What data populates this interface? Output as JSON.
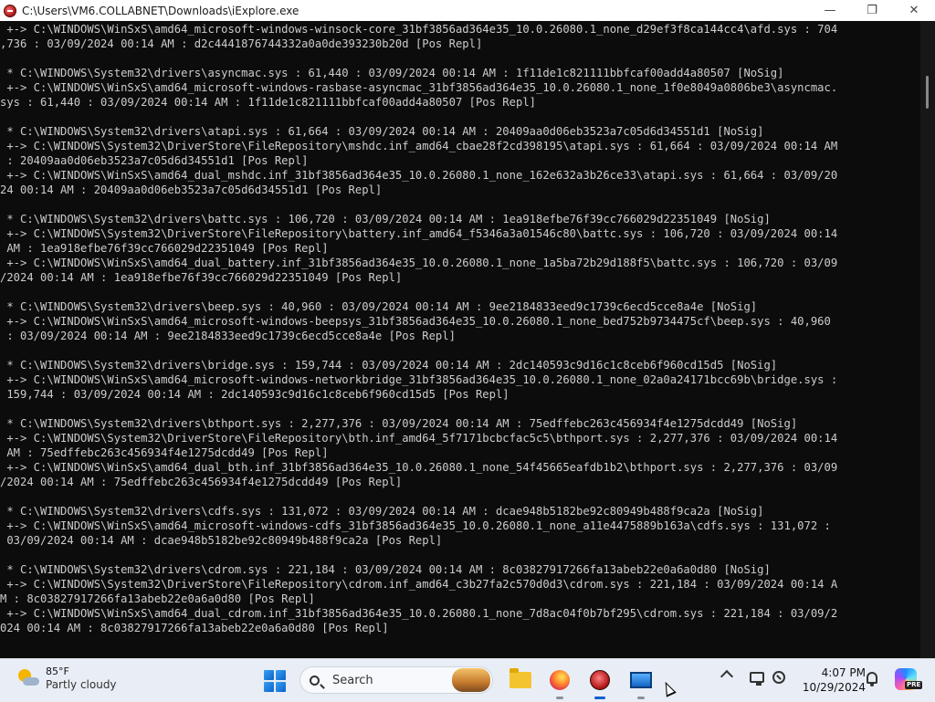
{
  "window": {
    "title": "C:\\Users\\VM6.COLLABNET\\Downloads\\iExplore.exe",
    "minimize_symbol": "—",
    "maximize_symbol": "❐",
    "close_symbol": "✕"
  },
  "console": {
    "lines": [
      " +-> C:\\WINDOWS\\WinSxS\\amd64_microsoft-windows-winsock-core_31bf3856ad364e35_10.0.26080.1_none_d29ef3f8ca144cc4\\afd.sys : 704",
      ",736 : 03/09/2024 00:14 AM : d2c4441876744332a0a0de393230b20d [Pos Repl]",
      "",
      " * C:\\WINDOWS\\System32\\drivers\\asyncmac.sys : 61,440 : 03/09/2024 00:14 AM : 1f11de1c821111bbfcaf00add4a80507 [NoSig]",
      " +-> C:\\WINDOWS\\WinSxS\\amd64_microsoft-windows-rasbase-asyncmac_31bf3856ad364e35_10.0.26080.1_none_1f0e8049a0806be3\\asyncmac.",
      "sys : 61,440 : 03/09/2024 00:14 AM : 1f11de1c821111bbfcaf00add4a80507 [Pos Repl]",
      "",
      " * C:\\WINDOWS\\System32\\drivers\\atapi.sys : 61,664 : 03/09/2024 00:14 AM : 20409aa0d06eb3523a7c05d6d34551d1 [NoSig]",
      " +-> C:\\WINDOWS\\System32\\DriverStore\\FileRepository\\mshdc.inf_amd64_cbae28f2cd398195\\atapi.sys : 61,664 : 03/09/2024 00:14 AM",
      " : 20409aa0d06eb3523a7c05d6d34551d1 [Pos Repl]",
      " +-> C:\\WINDOWS\\WinSxS\\amd64_dual_mshdc.inf_31bf3856ad364e35_10.0.26080.1_none_162e632a3b26ce33\\atapi.sys : 61,664 : 03/09/20",
      "24 00:14 AM : 20409aa0d06eb3523a7c05d6d34551d1 [Pos Repl]",
      "",
      " * C:\\WINDOWS\\System32\\drivers\\battc.sys : 106,720 : 03/09/2024 00:14 AM : 1ea918efbe76f39cc766029d22351049 [NoSig]",
      " +-> C:\\WINDOWS\\System32\\DriverStore\\FileRepository\\battery.inf_amd64_f5346a3a01546c80\\battc.sys : 106,720 : 03/09/2024 00:14",
      " AM : 1ea918efbe76f39cc766029d22351049 [Pos Repl]",
      " +-> C:\\WINDOWS\\WinSxS\\amd64_dual_battery.inf_31bf3856ad364e35_10.0.26080.1_none_1a5ba72b29d188f5\\battc.sys : 106,720 : 03/09",
      "/2024 00:14 AM : 1ea918efbe76f39cc766029d22351049 [Pos Repl]",
      "",
      " * C:\\WINDOWS\\System32\\drivers\\beep.sys : 40,960 : 03/09/2024 00:14 AM : 9ee2184833eed9c1739c6ecd5cce8a4e [NoSig]",
      " +-> C:\\WINDOWS\\WinSxS\\amd64_microsoft-windows-beepsys_31bf3856ad364e35_10.0.26080.1_none_bed752b9734475cf\\beep.sys : 40,960",
      " : 03/09/2024 00:14 AM : 9ee2184833eed9c1739c6ecd5cce8a4e [Pos Repl]",
      "",
      " * C:\\WINDOWS\\System32\\drivers\\bridge.sys : 159,744 : 03/09/2024 00:14 AM : 2dc140593c9d16c1c8ceb6f960cd15d5 [NoSig]",
      " +-> C:\\WINDOWS\\WinSxS\\amd64_microsoft-windows-networkbridge_31bf3856ad364e35_10.0.26080.1_none_02a0a24171bcc69b\\bridge.sys :",
      " 159,744 : 03/09/2024 00:14 AM : 2dc140593c9d16c1c8ceb6f960cd15d5 [Pos Repl]",
      "",
      " * C:\\WINDOWS\\System32\\drivers\\bthport.sys : 2,277,376 : 03/09/2024 00:14 AM : 75edffebc263c456934f4e1275dcdd49 [NoSig]",
      " +-> C:\\WINDOWS\\System32\\DriverStore\\FileRepository\\bth.inf_amd64_5f7171bcbcfac5c5\\bthport.sys : 2,277,376 : 03/09/2024 00:14",
      " AM : 75edffebc263c456934f4e1275dcdd49 [Pos Repl]",
      " +-> C:\\WINDOWS\\WinSxS\\amd64_dual_bth.inf_31bf3856ad364e35_10.0.26080.1_none_54f45665eafdb1b2\\bthport.sys : 2,277,376 : 03/09",
      "/2024 00:14 AM : 75edffebc263c456934f4e1275dcdd49 [Pos Repl]",
      "",
      " * C:\\WINDOWS\\System32\\drivers\\cdfs.sys : 131,072 : 03/09/2024 00:14 AM : dcae948b5182be92c80949b488f9ca2a [NoSig]",
      " +-> C:\\WINDOWS\\WinSxS\\amd64_microsoft-windows-cdfs_31bf3856ad364e35_10.0.26080.1_none_a11e4475889b163a\\cdfs.sys : 131,072 :",
      " 03/09/2024 00:14 AM : dcae948b5182be92c80949b488f9ca2a [Pos Repl]",
      "",
      " * C:\\WINDOWS\\System32\\drivers\\cdrom.sys : 221,184 : 03/09/2024 00:14 AM : 8c03827917266fa13abeb22e0a6a0d80 [NoSig]",
      " +-> C:\\WINDOWS\\System32\\DriverStore\\FileRepository\\cdrom.inf_amd64_c3b27fa2c570d0d3\\cdrom.sys : 221,184 : 03/09/2024 00:14 A",
      "M : 8c03827917266fa13abeb22e0a6a0d80 [Pos Repl]",
      " +-> C:\\WINDOWS\\WinSxS\\amd64_dual_cdrom.inf_31bf3856ad364e35_10.0.26080.1_none_7d8ac04f0b7bf295\\cdrom.sys : 221,184 : 03/09/2",
      "024 00:14 AM : 8c03827917266fa13abeb22e0a6a0d80 [Pos Repl]"
    ]
  },
  "taskbar": {
    "weather": {
      "temperature": "85°F",
      "condition": "Partly cloudy"
    },
    "search_label": "Search",
    "clock": {
      "time": "4:07 PM",
      "date": "10/29/2024"
    },
    "copilot_badge": "PRE"
  },
  "colors": {
    "console_bg": "#0c0c0c",
    "console_text": "#cccccc",
    "taskbar_bg": "#e9eef6",
    "accent": "#0a5fd0"
  }
}
